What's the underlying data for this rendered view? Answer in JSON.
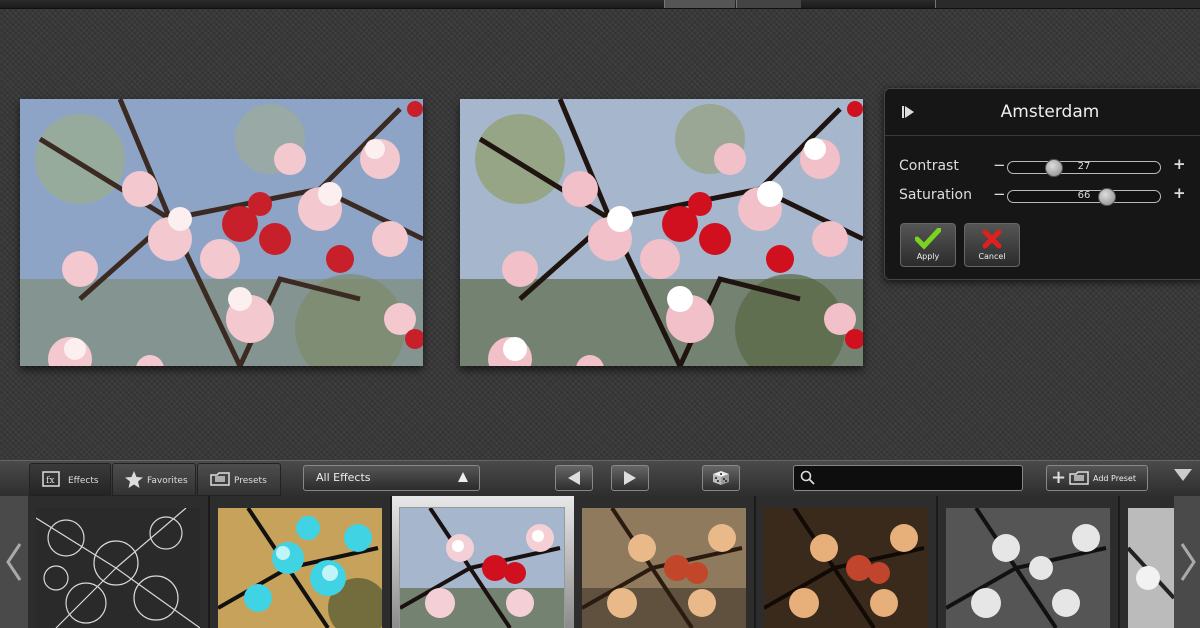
{
  "panel": {
    "title": "Amsterdam",
    "contrast_label": "Contrast",
    "contrast_value": "27",
    "contrast_level": 0.27,
    "saturation_label": "Saturation",
    "saturation_value": "66",
    "saturation_level": 0.66,
    "apply_label": "Apply",
    "cancel_label": "Cancel",
    "minus": "−",
    "plus": "+"
  },
  "toolbar": {
    "tabs": [
      {
        "label": "Effects",
        "icon": "effects-icon"
      },
      {
        "label": "Favorites",
        "icon": "star-icon"
      },
      {
        "label": "Presets",
        "icon": "presets-folder-icon"
      }
    ],
    "filter_select": "All Effects",
    "search_value": "",
    "add_preset_label": "Add Preset"
  },
  "colors": {
    "apply_check": "#7bd321",
    "cancel_x": "#e0201c",
    "panel_bg": "#161616"
  }
}
